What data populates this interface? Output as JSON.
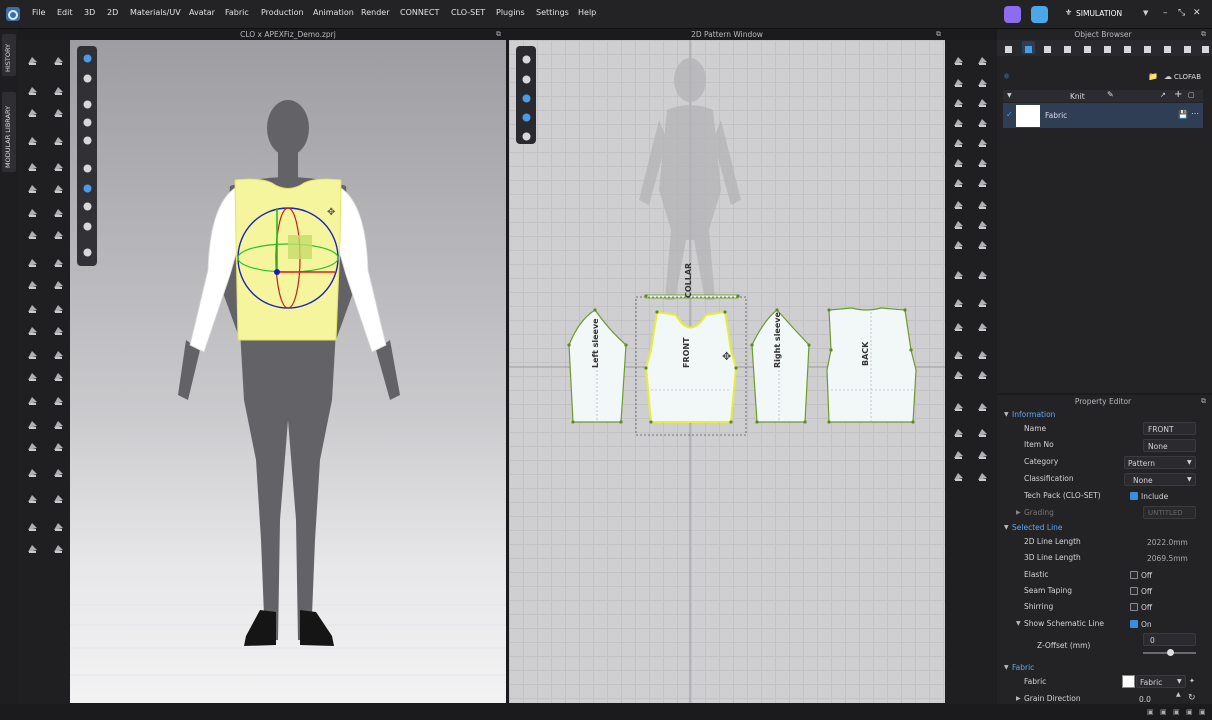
{
  "menu": [
    "File",
    "Edit",
    "3D",
    "2D",
    "Materials/UV",
    "Avatar",
    "Fabric",
    "Production",
    "Animation",
    "Render",
    "CONNECT",
    "CLO-SET",
    "Plugins",
    "Settings",
    "Help"
  ],
  "simulation": "SIMULATION",
  "window_controls": {
    "minimize": "–",
    "restore": "⤡",
    "close": "✕"
  },
  "side_tabs": {
    "history": "HISTORY",
    "modular": "MODULAR LIBRARY"
  },
  "view3d_title": "CLO x APEXFiz_Demo.zprj",
  "view2d_title": "2D Pattern Window",
  "patterns": {
    "collar": "COLLAR",
    "left_sleeve": "Left sleeve",
    "front": "FRONT",
    "right_sleeve": "Right sleeve",
    "back": "BACK"
  },
  "object_browser": {
    "title": "Object Browser",
    "brand": "CLOFAB",
    "group": "Knit",
    "fabric_item": "Fabric"
  },
  "property_editor": {
    "title": "Property Editor",
    "information": {
      "label": "Information",
      "name": {
        "label": "Name",
        "value": "FRONT"
      },
      "item_no": {
        "label": "Item No",
        "value": "None"
      },
      "category": {
        "label": "Category",
        "value": "Pattern"
      },
      "classification": {
        "label": "Classification",
        "value": "None"
      },
      "tech_pack": {
        "label": "Tech Pack (CLO-SET)",
        "value": "Include"
      },
      "grading": {
        "label": "Grading",
        "value": "UNTITLED"
      }
    },
    "selected_line": {
      "label": "Selected Line",
      "len2d": {
        "label": "2D Line Length",
        "value": "2022.0mm"
      },
      "len3d": {
        "label": "3D Line Length",
        "value": "2069.5mm"
      },
      "elastic": {
        "label": "Elastic",
        "value": "Off"
      },
      "seam": {
        "label": "Seam Taping",
        "value": "Off"
      },
      "shirring": {
        "label": "Shirring",
        "value": "Off"
      },
      "schematic": {
        "label": "Show Schematic Line",
        "value": "On"
      },
      "zoffset": {
        "label": "Z-Offset (mm)",
        "value": "0"
      }
    },
    "fabric": {
      "label": "Fabric",
      "fabric": {
        "label": "Fabric",
        "value": "Fabric"
      },
      "grain": {
        "label": "Grain Direction",
        "value": "0.0"
      }
    }
  },
  "colors": {
    "accent": "#3c8ce0",
    "garment": "#f4f59c",
    "avatar": "#606064"
  }
}
